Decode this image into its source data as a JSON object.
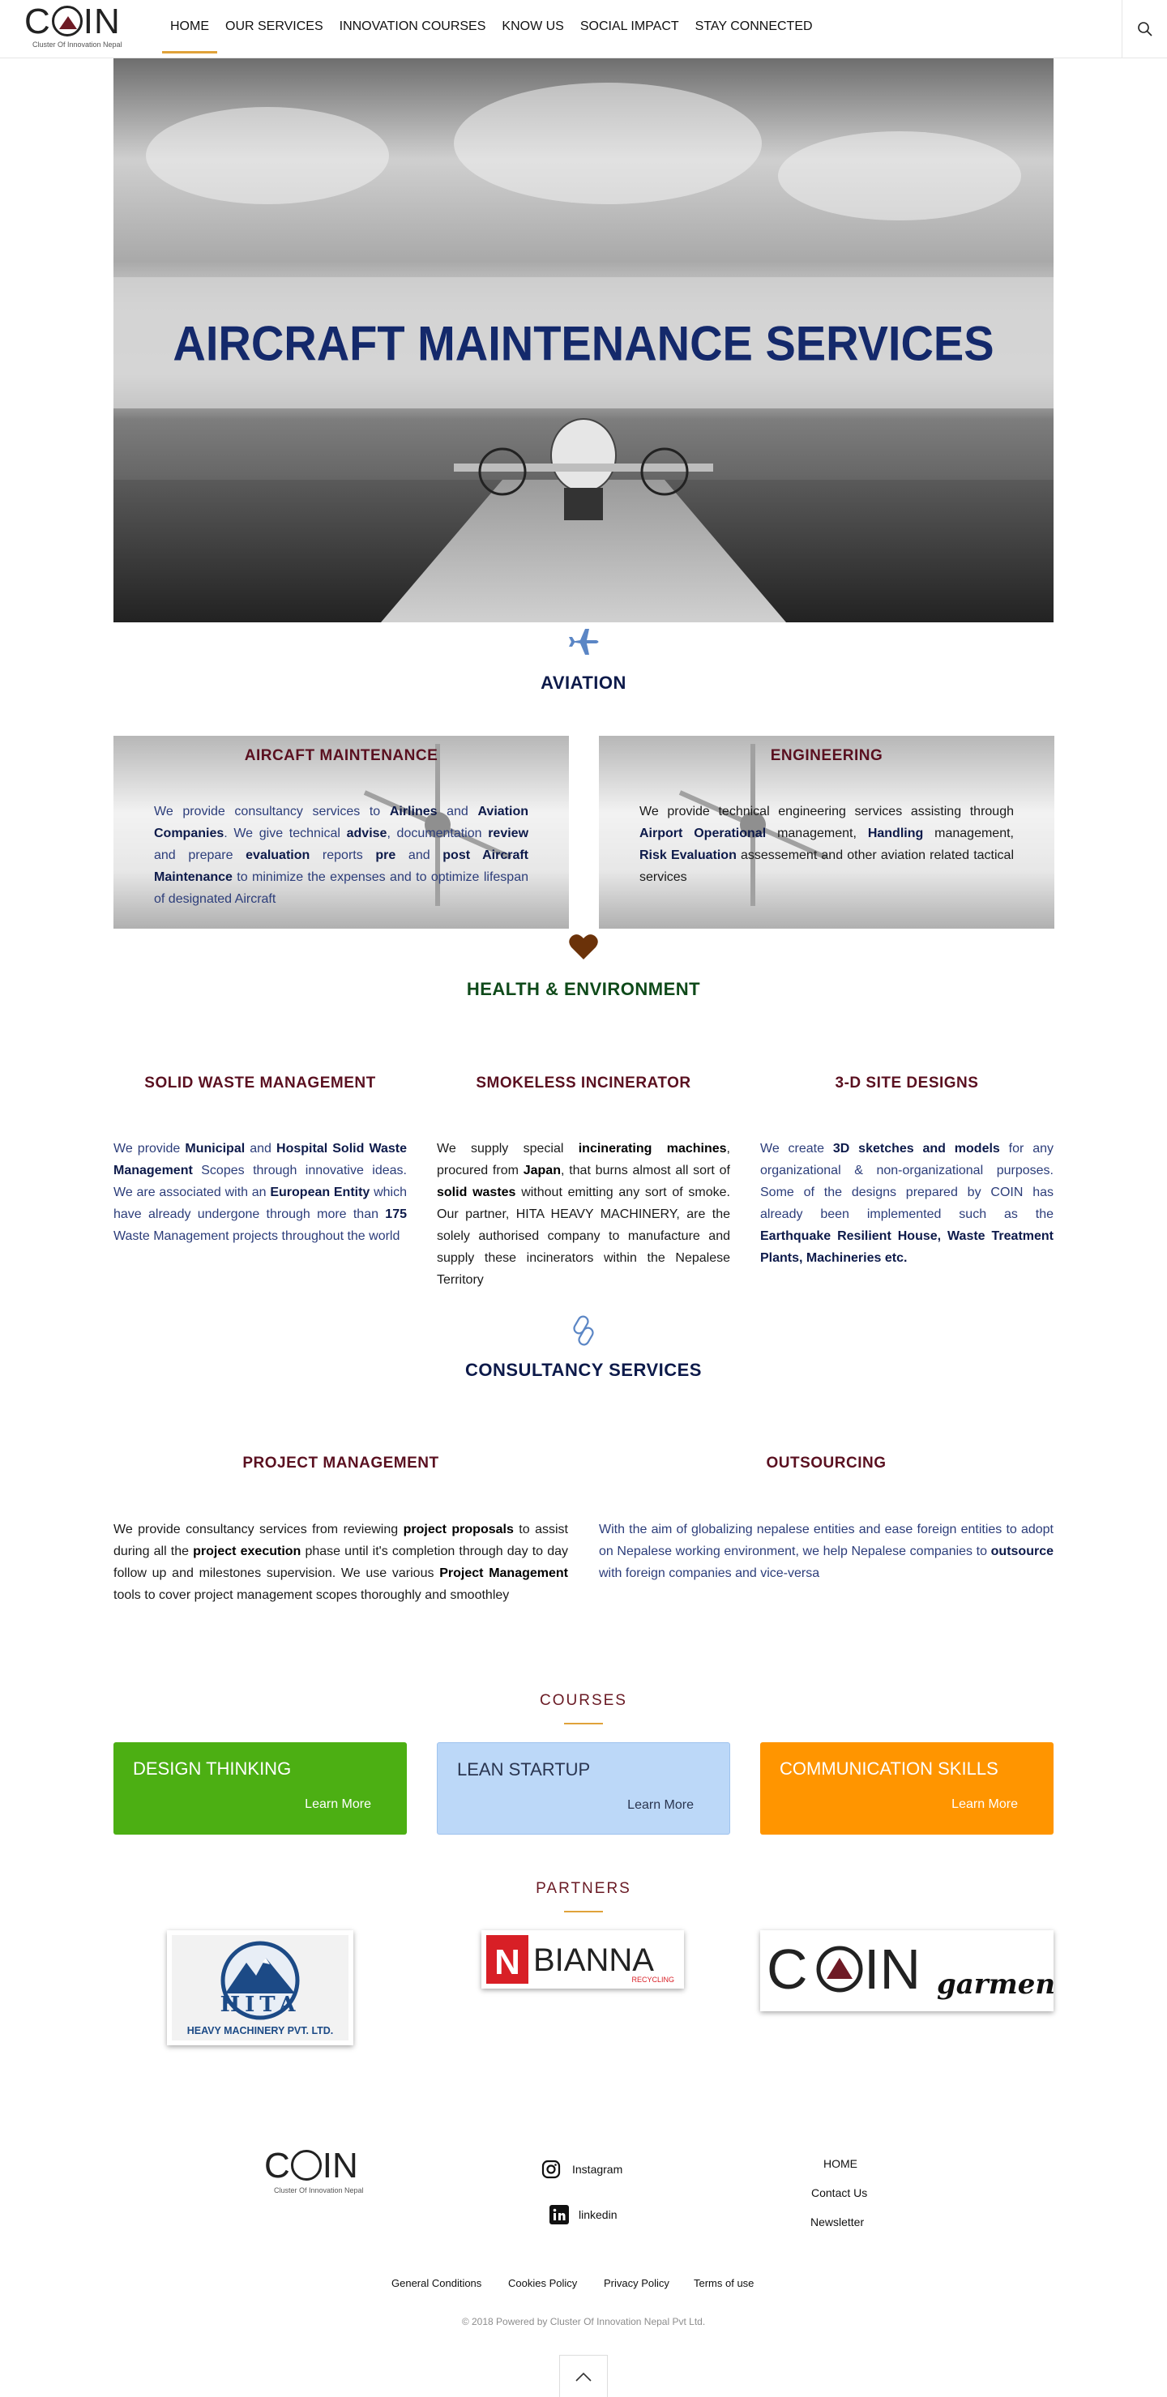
{
  "header": {
    "logo_text": "COIN",
    "logo_sub": "Cluster Of Innovation Nepal",
    "nav": [
      "HOME",
      "OUR SERVICES",
      "INNOVATION COURSES",
      "KNOW US",
      "SOCIAL IMPACT",
      "STAY CONNECTED"
    ],
    "active_nav": "HOME",
    "search_icon": "search-icon"
  },
  "hero": {
    "title": "AIRCRAFT MAINTENANCE SERVICES"
  },
  "aviation": {
    "icon": "airplane-icon",
    "title": "AVIATION",
    "cards": [
      {
        "title": "AIRCAFT MAINTENANCE",
        "parts": [
          {
            "t": "We provide consultancy services to ",
            "b": false
          },
          {
            "t": "Airlines",
            "b": true
          },
          {
            "t": " and ",
            "b": false
          },
          {
            "t": "Aviation Companies",
            "b": true
          },
          {
            "t": ". We give technical ",
            "b": false
          },
          {
            "t": "advise",
            "b": true
          },
          {
            "t": ", documentation ",
            "b": false
          },
          {
            "t": "review",
            "b": true
          },
          {
            "t": " and prepare ",
            "b": false
          },
          {
            "t": "evaluation",
            "b": true
          },
          {
            "t": " reports ",
            "b": false
          },
          {
            "t": "pre",
            "b": true
          },
          {
            "t": " and ",
            "b": false
          },
          {
            "t": "post Aircraft Maintenance",
            "b": true
          },
          {
            "t": " to minimize the expenses and to optimize lifespan of designated Aircraft",
            "b": false
          }
        ]
      },
      {
        "title": "ENGINEERING",
        "parts": [
          {
            "t": "We provide technical engineering services assisting through ",
            "b": false
          },
          {
            "t": "Airport Operational",
            "b": true
          },
          {
            "t": " management, ",
            "b": false
          },
          {
            "t": "Handling",
            "b": true
          },
          {
            "t": " management, ",
            "b": false
          },
          {
            "t": "Risk Evaluation",
            "b": true
          },
          {
            "t": " assessement and other aviation related tactical services",
            "b": false
          }
        ]
      }
    ]
  },
  "health": {
    "icon": "heart-icon",
    "title": "HEALTH & ENVIRONMENT",
    "columns": [
      {
        "title": "SOLID WASTE MANAGEMENT",
        "parts": [
          {
            "t": "We provide ",
            "b": false
          },
          {
            "t": "Municipal",
            "b": true
          },
          {
            "t": " and ",
            "b": false
          },
          {
            "t": "Hospital Solid Waste Management",
            "b": true
          },
          {
            "t": " Scopes through innovative ideas. We are associated with an ",
            "b": false
          },
          {
            "t": "European Entity",
            "b": true
          },
          {
            "t": " which have already undergone through more than ",
            "b": false
          },
          {
            "t": "175",
            "b": true
          },
          {
            "t": " Waste Management projects throughout the world",
            "b": false
          }
        ]
      },
      {
        "title": "SMOKELESS INCINERATOR",
        "parts": [
          {
            "t": "We supply special ",
            "b": false
          },
          {
            "t": "incinerating machines",
            "b": true
          },
          {
            "t": ", procured from ",
            "b": false
          },
          {
            "t": "Japan",
            "b": true
          },
          {
            "t": ", that burns almost all sort of ",
            "b": false
          },
          {
            "t": "solid wastes",
            "b": true
          },
          {
            "t": " without emitting any sort of smoke. Our partner, HITA HEAVY MACHINERY, are the solely authorised company to manufacture and supply these incinerators within the Nepalese Territory",
            "b": false
          }
        ]
      },
      {
        "title": "3-D SITE DESIGNS",
        "parts": [
          {
            "t": "We create ",
            "b": false
          },
          {
            "t": "3D sketches and models",
            "b": true
          },
          {
            "t": " for any organizational & non-organizational purposes. Some of the designs prepared by COIN has already been implemented such as the ",
            "b": false
          },
          {
            "t": "Earthquake Resilient House, Waste Treatment Plants, Machineries etc.",
            "b": true
          }
        ]
      }
    ]
  },
  "consultancy": {
    "icon": "link-icon",
    "title": "CONSULTANCY SERVICES",
    "columns": [
      {
        "title": "PROJECT MANAGEMENT",
        "parts": [
          {
            "t": "We provide  consultancy services from reviewing ",
            "b": false
          },
          {
            "t": "project proposals",
            "b": true
          },
          {
            "t": " to assist during all the ",
            "b": false
          },
          {
            "t": "project execution",
            "b": true
          },
          {
            "t": " phase until it's completion through day to day follow up and milestones supervision. We use various ",
            "b": false
          },
          {
            "t": "Project Management",
            "b": true
          },
          {
            "t": " tools to cover project management scopes thoroughly and smoothley",
            "b": false
          }
        ]
      },
      {
        "title": "OUTSOURCING",
        "parts": [
          {
            "t": "With the aim of globalizing nepalese entities and ease foreign entities to adopt on Nepalese working environment, we help Nepalese companies to ",
            "b": false
          },
          {
            "t": "outsource",
            "b": true
          },
          {
            "t": " with foreign companies and vice-versa",
            "b": false
          }
        ]
      }
    ]
  },
  "courses": {
    "heading": "COURSES",
    "items": [
      {
        "name": "DESIGN THINKING",
        "more": "Learn More",
        "bg": "#4caf13",
        "fg": "#ffffff"
      },
      {
        "name": "LEAN STARTUP",
        "more": "Learn More",
        "bg": "#bcd8f8",
        "fg": "#2a3550"
      },
      {
        "name": "COMMUNICATION SKILLS",
        "more": "Learn More",
        "bg": "#ff9500",
        "fg": "#ffffff"
      }
    ]
  },
  "partners": {
    "heading": "PARTNERS",
    "items": [
      {
        "name": "HITA",
        "sub": "HEAVY MACHINERY PVT. LTD."
      },
      {
        "name": "BIANNA",
        "sub": "RECYCLING"
      },
      {
        "name": "COIN",
        "sub": "garments"
      }
    ]
  },
  "footer": {
    "logo_text": "COIN",
    "logo_sub": "Cluster Of Innovation Nepal",
    "social": [
      {
        "label": "Instagram",
        "icon": "instagram-icon"
      },
      {
        "label": "linkedin",
        "icon": "linkedin-icon"
      }
    ],
    "links": [
      "HOME",
      "Contact Us",
      "Newsletter"
    ],
    "legal": [
      "General Conditions",
      "Cookies Policy",
      "Privacy Policy",
      "Terms of use"
    ],
    "copyright": "© 2018 Powered by Cluster Of Innovation Nepal Pvt Ltd.",
    "to_top_icon": "chevron-up-icon"
  }
}
